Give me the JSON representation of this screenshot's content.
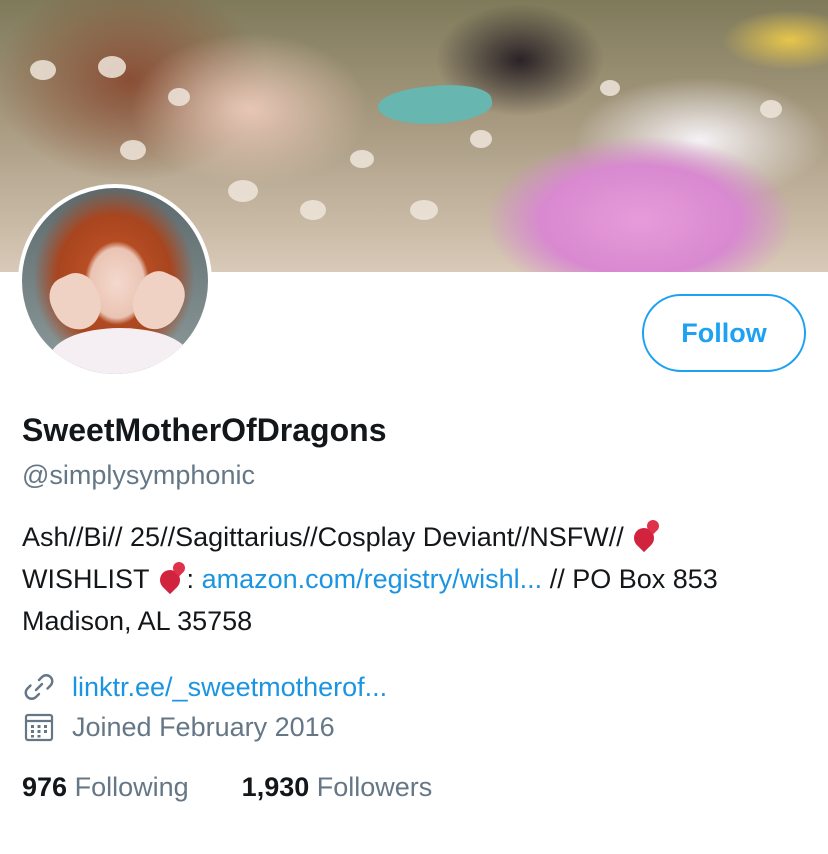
{
  "profile": {
    "display_name": "SweetMotherOfDragons",
    "handle": "@simplysymphonic",
    "follow_label": "Follow",
    "bio": {
      "line1": "Ash//Bi// 25//Sagittarius//Cosplay Deviant//NSFW//",
      "wishlist_label": "WISHLIST",
      "colon": ":",
      "wishlist_link": "amazon.com/registry/wishl...",
      "po_box": "// PO Box 853 Madison, AL 35758"
    },
    "website": "linktr.ee/_sweetmotherof...",
    "joined": "Joined February 2016",
    "following_count": "976",
    "following_label": "Following",
    "followers_count": "1,930",
    "followers_label": "Followers"
  },
  "icons": {
    "link": "link-icon",
    "calendar": "calendar-icon",
    "heart": "two-hearts-icon"
  },
  "colors": {
    "accent": "#1da1f2",
    "link": "#1b95e0",
    "secondary_text": "#657786",
    "primary_text": "#14171a"
  }
}
